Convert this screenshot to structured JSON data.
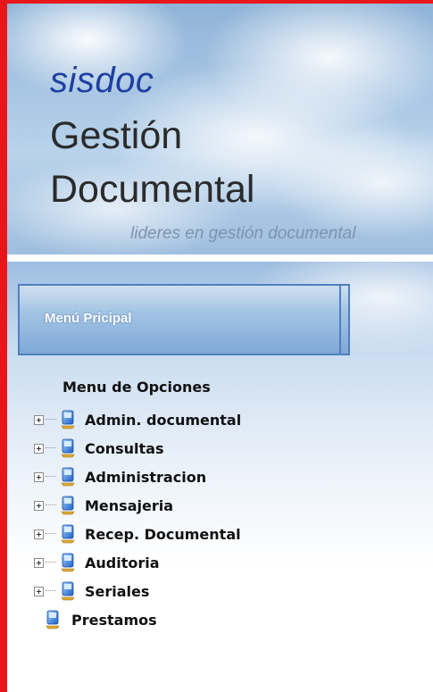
{
  "header": {
    "brand": "sisdoc",
    "title_line1": "Gestión",
    "title_line2": "Documental",
    "tagline": "lideres en gestión documental"
  },
  "menu": {
    "title": "Menú Pricipal",
    "options_title": "Menu de Opciones",
    "items": [
      {
        "label": "Admin. documental",
        "expandable": true
      },
      {
        "label": "Consultas",
        "expandable": true
      },
      {
        "label": "Administracion",
        "expandable": true
      },
      {
        "label": "Mensajeria",
        "expandable": true
      },
      {
        "label": "Recep. Documental",
        "expandable": true
      },
      {
        "label": "Auditoria",
        "expandable": true
      },
      {
        "label": "Seriales",
        "expandable": true
      },
      {
        "label": "Prestamos",
        "expandable": false
      }
    ]
  },
  "colors": {
    "frame_border": "#e8161b",
    "brand": "#1f3fa1",
    "menu_border": "#4f7fbf"
  },
  "icons": {
    "tree_expand": "plus-box-icon",
    "node": "computer-icon"
  }
}
